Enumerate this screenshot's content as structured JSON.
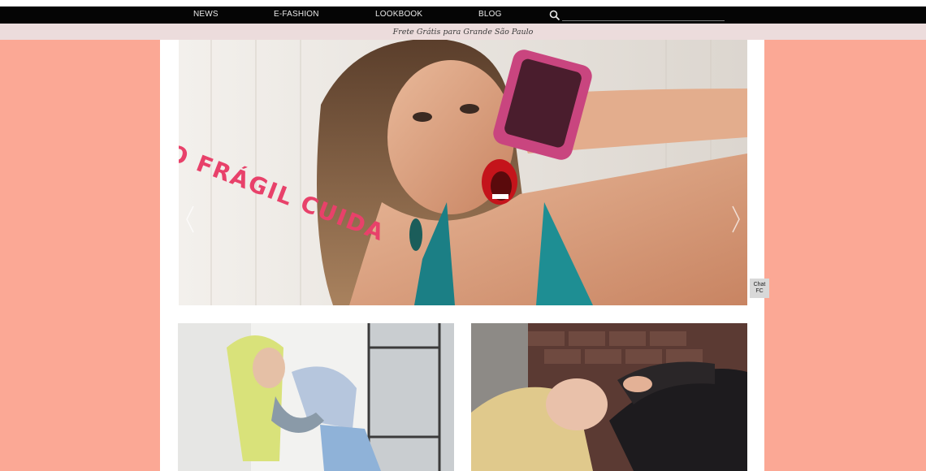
{
  "nav": {
    "items": [
      {
        "label": "NEWS"
      },
      {
        "label": "E-FASHION"
      },
      {
        "label": "LOOKBOOK"
      },
      {
        "label": "BLOG"
      }
    ],
    "search_icon": "search-icon",
    "search_placeholder": ""
  },
  "promo": {
    "text": "Frete Grátis para Grande São Paulo"
  },
  "hero": {
    "tape_text": "O FRÁGIL  CUIDA",
    "prev_icon": "chevron-left-icon",
    "next_icon": "chevron-right-icon"
  },
  "chat": {
    "line1": "Chat",
    "line2": "FC"
  },
  "colors": {
    "background_side": "#fba895",
    "navbar": "#050505",
    "promo_bar": "#ecdcdc",
    "content": "#ffffff"
  }
}
